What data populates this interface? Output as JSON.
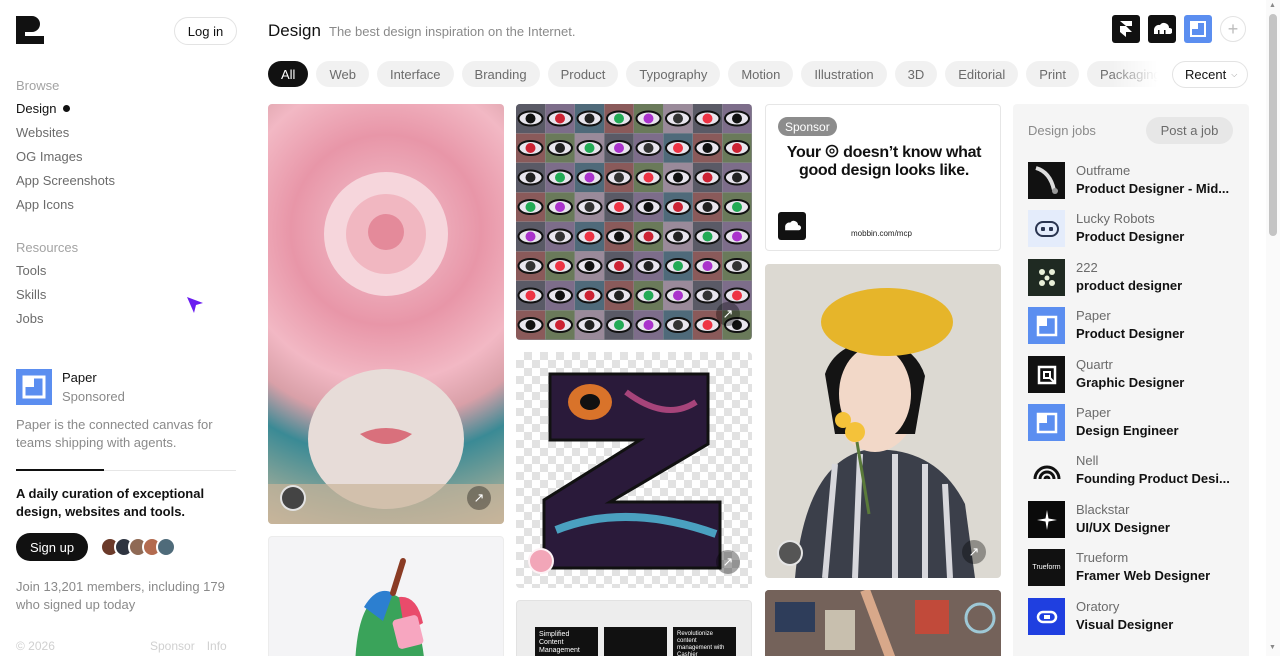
{
  "auth": {
    "login_label": "Log in"
  },
  "nav": {
    "browse_heading": "Browse",
    "browse_items": [
      "Design",
      "Websites",
      "OG Images",
      "App Screenshots",
      "App Icons"
    ],
    "resources_heading": "Resources",
    "resource_items": [
      "Tools",
      "Skills",
      "Jobs"
    ],
    "active_item": "Design"
  },
  "sponsor": {
    "name": "Paper",
    "label": "Sponsored",
    "description": "Paper is the connected canvas for teams shipping with agents.",
    "carousel_progress": 0.4
  },
  "promo": {
    "tagline": "A daily curation of exceptional design, websites and tools.",
    "signup_label": "Sign up",
    "join_text": "Join 13,201 members, including 179 who signed up today"
  },
  "footer": {
    "copyright": "© 2026",
    "links": [
      "Sponsor",
      "Info"
    ]
  },
  "header": {
    "title": "Design",
    "subtitle": "The best design inspiration on the Internet."
  },
  "filters": {
    "chips": [
      "All",
      "Web",
      "Interface",
      "Branding",
      "Product",
      "Typography",
      "Motion",
      "Illustration",
      "3D",
      "Editorial",
      "Print",
      "Packaging"
    ],
    "active": "All",
    "sort_value": "Recent"
  },
  "ad": {
    "badge": "Sponsor",
    "headline_before": "Your",
    "headline_after": "doesn’t know what good design looks like.",
    "url": "mobbin.com/mcp"
  },
  "thumb": {
    "doc_line_1": "Simplified Content Management",
    "doc_line_2": "Revolutionize content management with Cashier"
  },
  "jobs": {
    "title": "Design jobs",
    "post_label": "Post a job",
    "items": [
      {
        "company": "Outframe",
        "title": "Product Designer - Mid...",
        "logo_bg": "#111111"
      },
      {
        "company": "Lucky Robots",
        "title": "Product Designer",
        "logo_bg": "#e4ecfb"
      },
      {
        "company": "222",
        "title": "product designer",
        "logo_bg": "#1f2a22"
      },
      {
        "company": "Paper",
        "title": "Product Designer",
        "logo_bg": "#5b8ef0"
      },
      {
        "company": "Quartr",
        "title": "Graphic Designer",
        "logo_bg": "#111111"
      },
      {
        "company": "Paper",
        "title": "Design Engineer",
        "logo_bg": "#5b8ef0"
      },
      {
        "company": "Nell",
        "title": "Founding Product Desi...",
        "logo_bg": "#f5f5f5"
      },
      {
        "company": "Blackstar",
        "title": "UI/UX Designer",
        "logo_bg": "#0a0a0a"
      },
      {
        "company": "Trueform",
        "title": "Framer Web Designer",
        "logo_bg": "#111111",
        "logo_text": "Trueform"
      },
      {
        "company": "Oratory",
        "title": "Visual Designer",
        "logo_bg": "#1f3fe0"
      }
    ]
  },
  "colors": {
    "accent": "#111111",
    "chip_bg": "#f1f1f1",
    "muted": "#8a8a8a",
    "paper_blue": "#5b8ef0",
    "cursor": "#6a1cf0"
  }
}
